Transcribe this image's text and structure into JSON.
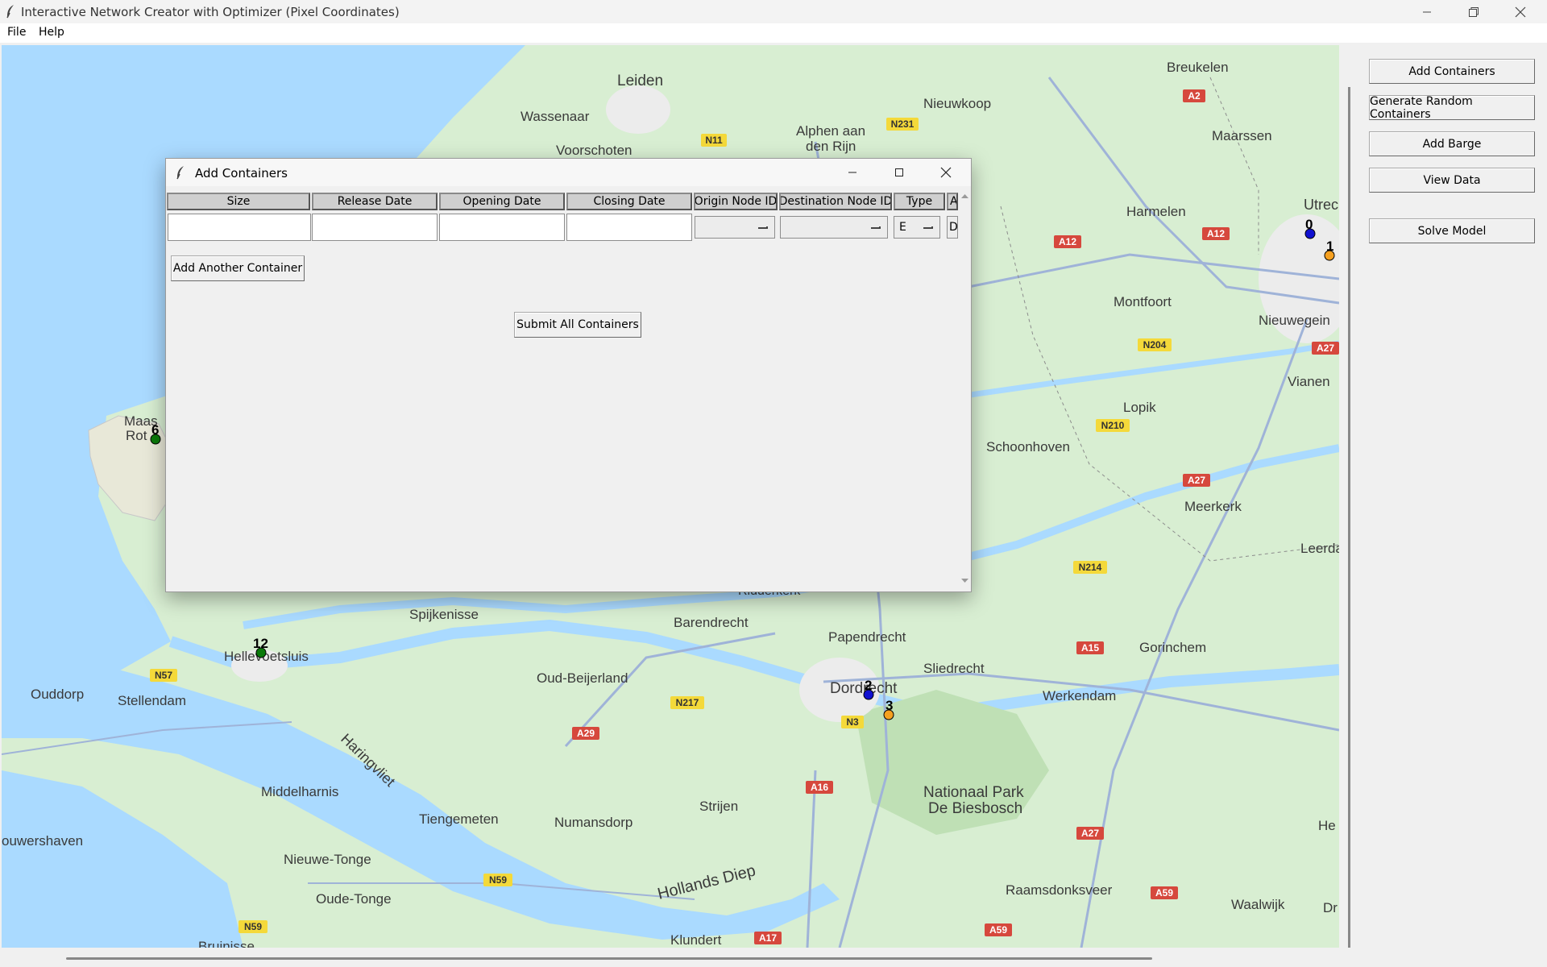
{
  "window": {
    "title": "Interactive Network Creator with Optimizer (Pixel Coordinates)"
  },
  "menu": {
    "file": "File",
    "help": "Help"
  },
  "sidebar": {
    "add_containers": "Add Containers",
    "generate_random": "Generate Random Containers",
    "add_barge": "Add Barge",
    "view_data": "View Data",
    "solve_model": "Solve Model"
  },
  "map": {
    "places": {
      "leiden": "Leiden",
      "wassenaar": "Wassenaar",
      "voorschoten": "Voorschoten",
      "alphen1": "Alphen aan",
      "alphen2": "den Rijn",
      "nieuwkoop": "Nieuwkoop",
      "breukelen": "Breukelen",
      "maarssen": "Maarssen",
      "harmelen": "Harmelen",
      "utrecht": "Utrec",
      "montfoort": "Montfoort",
      "nieuwegein": "Nieuwegein",
      "vianen": "Vianen",
      "lopik": "Lopik",
      "schoonhoven": "Schoonhoven",
      "meerkerk": "Meerkerk",
      "leerdam": "Leerdam",
      "gorinchem": "Gorinchem",
      "sliedrecht": "Sliedrecht",
      "werkendam": "Werkendam",
      "papendrecht": "Papendrecht",
      "dordrecht": "Dordrecht",
      "barendrecht": "Barendrecht",
      "ridderkerk": "Ridderkerk",
      "spijkenisse": "Spijkenisse",
      "hellevoetsluis": "Hellevoetsluis",
      "oud_beijerland": "Oud-Beijerland",
      "ouddorp": "Ouddorp",
      "stellendam": "Stellendam",
      "middelharnis": "Middelharnis",
      "tiengemeten": "Tiengemeten",
      "numansdorp": "Numansdorp",
      "strijen": "Strijen",
      "nationaal1": "Nationaal Park",
      "nationaal2": "De Biesbosch",
      "ouwershaven": "ouwershaven",
      "nieuwe_tonge": "Nieuwe-Tonge",
      "oude_tonge": "Oude-Tonge",
      "raamsdonksveer": "Raamsdonksveer",
      "waalwijk": "Waalwijk",
      "klundert": "Klundert",
      "bruinisse": "Bruinisse",
      "haringvliet": "Haringvliet",
      "hollands_diep": "Hollands Diep",
      "maasvlakte1": "Maas",
      "maasvlakte2": "Rot",
      "he": "He",
      "dr": "Dr"
    },
    "roads": {
      "a2": "A2",
      "n231": "N231",
      "n11": "N11",
      "a12a": "A12",
      "a12b": "A12",
      "n204": "N204",
      "a27a": "A27",
      "n210": "N210",
      "a27b": "A27",
      "n214": "N214",
      "a15": "A15",
      "n57": "N57",
      "n217": "N217",
      "a29": "A29",
      "n3": "N3",
      "a16": "A16",
      "a27c": "A27",
      "n59a": "N59",
      "n59b": "N59",
      "a59a": "A59",
      "a59b": "A59",
      "a17": "A17"
    },
    "road_colors": {
      "motorway": "#d6483d",
      "provincial": "#f4d93a"
    },
    "nodes": [
      {
        "id": "0",
        "color": "#1010d0"
      },
      {
        "id": "1",
        "color": "#f5a020"
      },
      {
        "id": "2",
        "color": "#1010d0"
      },
      {
        "id": "3",
        "color": "#f5a020"
      },
      {
        "id": "6",
        "color": "#0a7a0a"
      },
      {
        "id": "12",
        "color": "#0a7a0a"
      }
    ]
  },
  "dialog": {
    "title": "Add Containers",
    "columns": {
      "size": "Size",
      "release": "Release Date",
      "opening": "Opening Date",
      "closing": "Closing Date",
      "origin": "Origin Node ID",
      "destination": "Destination Node ID",
      "type": "Type",
      "extra": "A"
    },
    "row": {
      "size": "",
      "release": "",
      "opening": "",
      "closing": "",
      "origin": "",
      "destination": "",
      "type": "E",
      "extra": "D"
    },
    "add_another": "Add Another Container",
    "submit_all": "Submit All Containers"
  }
}
